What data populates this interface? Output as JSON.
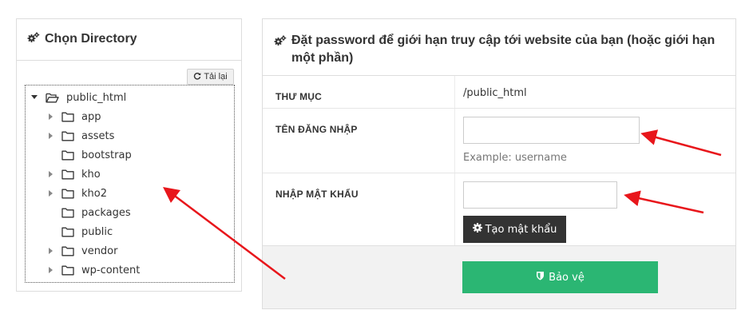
{
  "left_panel": {
    "title": "Chọn Directory",
    "reload_label": "Tải lại",
    "tree": {
      "root": {
        "label": "public_html",
        "expanded": true
      },
      "children": [
        {
          "label": "app",
          "has_children": true
        },
        {
          "label": "assets",
          "has_children": true
        },
        {
          "label": "bootstrap",
          "has_children": false
        },
        {
          "label": "kho",
          "has_children": true
        },
        {
          "label": "kho2",
          "has_children": true
        },
        {
          "label": "packages",
          "has_children": false
        },
        {
          "label": "public",
          "has_children": false
        },
        {
          "label": "vendor",
          "has_children": true
        },
        {
          "label": "wp-content",
          "has_children": true
        }
      ]
    }
  },
  "right_panel": {
    "title": "Đặt password để giới hạn truy cập tới website của bạn (hoặc giới hạn một phần)",
    "directory": {
      "label": "THƯ MỤC",
      "value": "/public_html"
    },
    "username": {
      "label": "TÊN ĐĂNG NHẬP",
      "value": "",
      "help": "Example: username"
    },
    "password": {
      "label": "NHẬP MẬT KHẨU",
      "value": "",
      "generate_label": "Tạo mật khẩu"
    },
    "protect_label": "Bảo vệ"
  },
  "colors": {
    "protect_button": "#2bb673",
    "generate_button": "#333333",
    "annotation_arrows": "#e8161b"
  },
  "icons": {
    "panel_heading": "cogs-icon",
    "reload": "refresh-icon",
    "generate": "gear-icon",
    "protect": "shield-icon",
    "tree_folder": "folder-icon",
    "tree_folder_open": "folder-open-icon"
  }
}
